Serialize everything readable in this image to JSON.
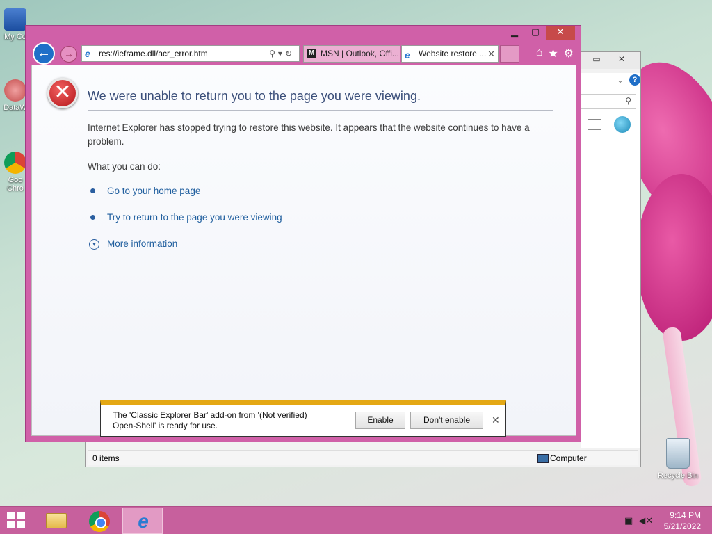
{
  "desktop": {
    "icons": [
      {
        "label": "My Co"
      },
      {
        "label": "DataW"
      },
      {
        "label": "Goo Chro"
      }
    ],
    "recycle_bin": "Recycle Bin"
  },
  "explorer": {
    "status_items": "0 items",
    "status_location": "Computer"
  },
  "ie": {
    "address": "res://ieframe.dll/acr_error.htm",
    "tabs": [
      {
        "label": "MSN | Outlook, Offi..."
      },
      {
        "label": "Website restore ..."
      }
    ],
    "error": {
      "title": "We were unable to return you to the page you were viewing.",
      "body": "Internet Explorer has stopped trying to restore this website. It appears that the website continues to have a problem.",
      "what_you_can_do": "What you can do:",
      "links": [
        "Go to your home page",
        "Try to return to the page you were viewing",
        "More information"
      ]
    },
    "notification": {
      "message": "The 'Classic Explorer Bar' add-on from '(Not verified) Open-Shell' is ready for use.",
      "enable": "Enable",
      "dont_enable": "Don't enable"
    }
  },
  "taskbar": {
    "time": "9:14 PM",
    "date": "5/21/2022"
  },
  "colors": {
    "ie_frame": "#d060a8",
    "taskbar": "#c7609d",
    "notification_bar": "#e4a814",
    "link": "#1f5e9e"
  }
}
